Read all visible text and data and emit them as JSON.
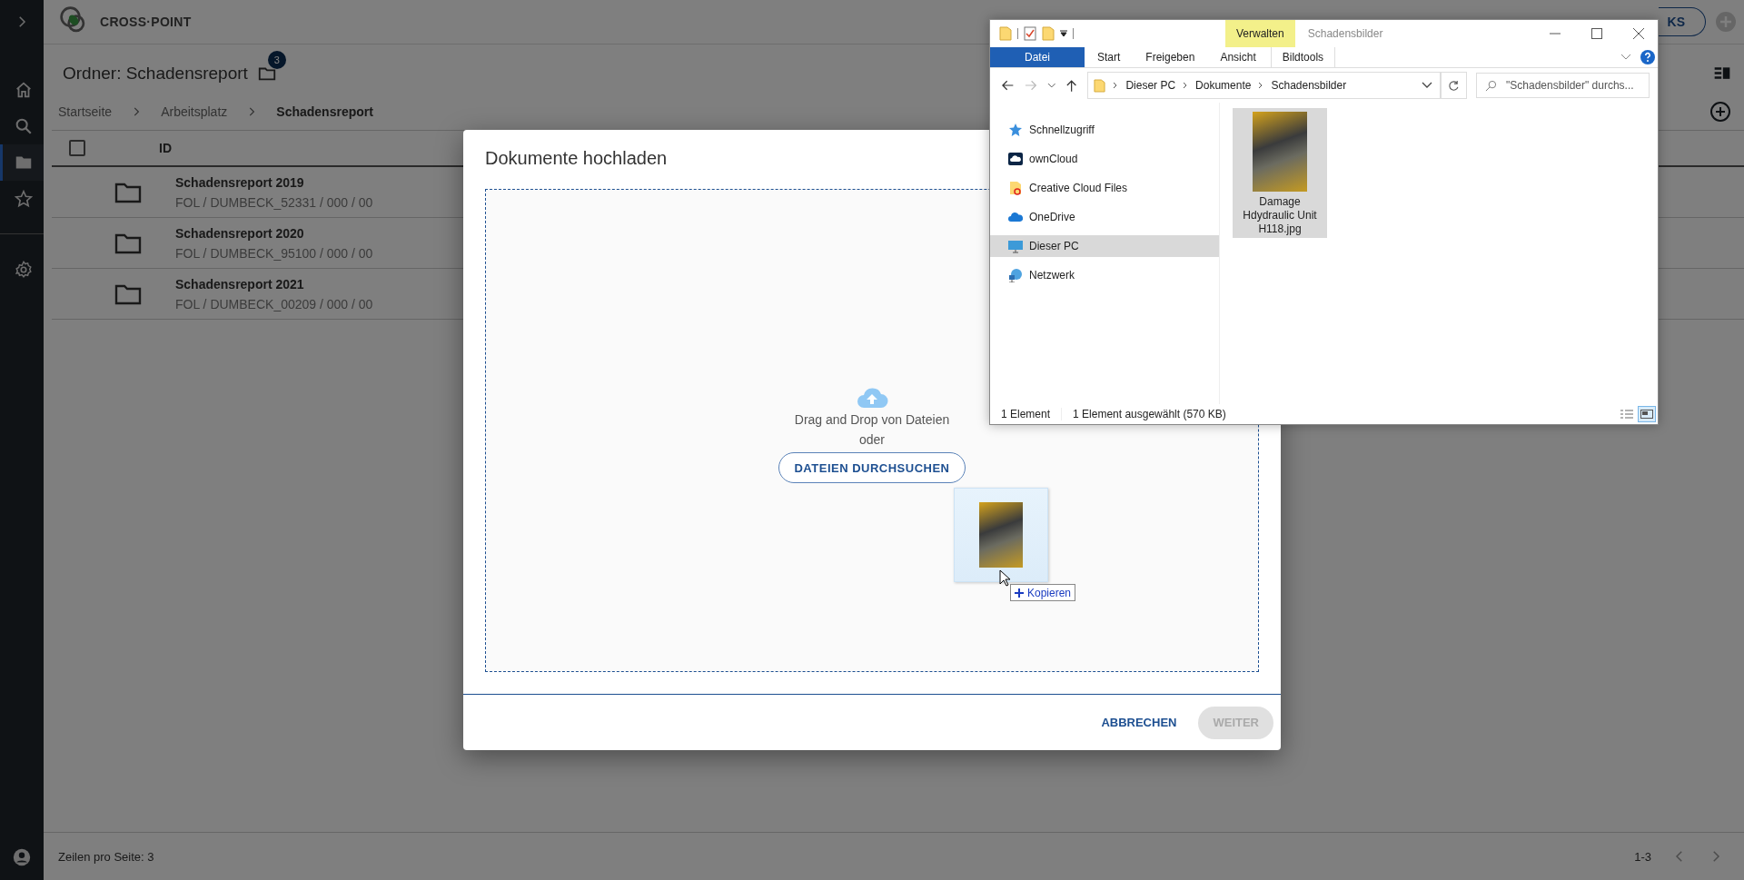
{
  "sidebar": {
    "items": [
      {
        "kind": "home",
        "selected": false
      },
      {
        "kind": "search",
        "selected": false
      },
      {
        "kind": "folder",
        "selected": true
      },
      {
        "kind": "star",
        "selected": false
      },
      {
        "kind": "settings",
        "selected": false
      }
    ]
  },
  "header": {
    "brand": "CROSS·POINT",
    "bookmarks_button": "KS"
  },
  "page": {
    "title": "Ordner: Schadensreport",
    "count_badge": "3",
    "breadcrumbs": [
      {
        "label": "Startseite",
        "current": false
      },
      {
        "label": "Arbeitsplatz",
        "current": false
      },
      {
        "label": "Schadensreport",
        "current": true
      }
    ]
  },
  "table": {
    "select_all_checked": false,
    "columns": [
      "ID"
    ],
    "rows": [
      {
        "name": "Schadensreport 2019",
        "path": "FOL / DUMBECK_52331 / 000 / 00"
      },
      {
        "name": "Schadensreport 2020",
        "path": "FOL / DUMBECK_95100 / 000 / 00"
      },
      {
        "name": "Schadensreport 2021",
        "path": "FOL / DUMBECK_00209 / 000 / 00"
      }
    ]
  },
  "footer": {
    "rows_per_page": "Zeilen pro Seite: 3",
    "range": "1-3"
  },
  "dialog": {
    "title": "Dokumente hochladen",
    "drop_hint": "Drag and Drop von Dateien",
    "or": "oder",
    "browse_button": "DATEIEN DURCHSUCHEN",
    "buttons": [
      {
        "label": "ABBRECHEN",
        "disabled": false
      },
      {
        "label": "WEITER",
        "disabled": true
      }
    ]
  },
  "drag": {
    "tooltip": "Kopieren"
  },
  "explorer": {
    "title": "Schadensbilder",
    "context_tab": "Verwalten",
    "ribbon_tabs": [
      {
        "label": "Datei",
        "kind": "file"
      },
      {
        "label": "Start",
        "kind": "tab"
      },
      {
        "label": "Freigeben",
        "kind": "tab"
      },
      {
        "label": "Ansicht",
        "kind": "tab"
      },
      {
        "label": "Bildtools",
        "kind": "context"
      }
    ],
    "address": [
      "Dieser PC",
      "Dokumente",
      "Schadensbilder"
    ],
    "search": {
      "placeholder": "\"Schadensbilder\" durchs..."
    },
    "nav": [
      {
        "label": "Schnellzugriff",
        "kind": "quick",
        "selected": false
      },
      {
        "label": "ownCloud",
        "kind": "owncloud",
        "selected": false
      },
      {
        "label": "Creative Cloud Files",
        "kind": "creative",
        "selected": false
      },
      {
        "label": "OneDrive",
        "kind": "onedrive",
        "selected": false
      },
      {
        "label": "Dieser PC",
        "kind": "pc",
        "selected": true
      },
      {
        "label": "Netzwerk",
        "kind": "network",
        "selected": false
      }
    ],
    "files": [
      {
        "name": "Damage Hdydraulic Unit H118.jpg",
        "selected": true
      }
    ],
    "status": [
      "1 Element",
      "1 Element ausgewählt (570 KB)"
    ],
    "views": [
      {
        "kind": "details",
        "selected": false
      },
      {
        "kind": "thumbnails",
        "selected": true
      }
    ]
  }
}
